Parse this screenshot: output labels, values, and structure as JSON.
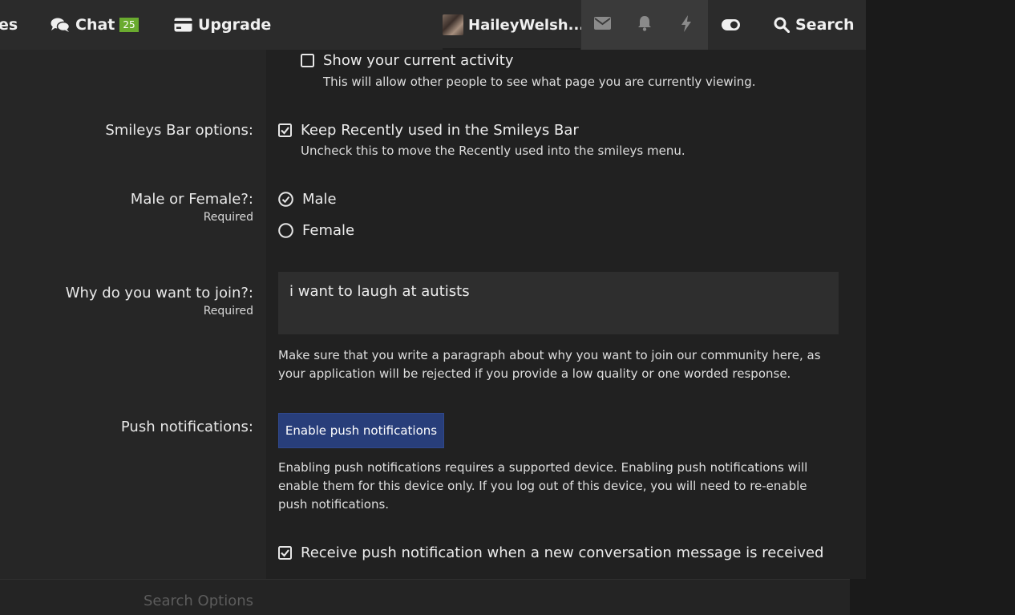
{
  "nav": {
    "partial_item": "es",
    "chat_label": "Chat",
    "chat_badge": "25",
    "upgrade_label": "Upgrade",
    "username": "HaileyWelsh...",
    "search_label": "Search"
  },
  "preferences": {
    "activity": {
      "label": "Show your current activity",
      "hint": "This will allow other people to see what page you are currently viewing.",
      "checked": false
    },
    "smileys": {
      "row_label": "Smileys Bar options:",
      "label": "Keep Recently used in the Smileys Bar",
      "hint": "Uncheck this to move the Recently used into the smileys menu.",
      "checked": true
    },
    "gender": {
      "row_label": "Male or Female?:",
      "required": "Required",
      "options": [
        "Male",
        "Female"
      ],
      "selected": "Male"
    },
    "join": {
      "row_label": "Why do you want to join?:",
      "required": "Required",
      "value": "i want to laugh at autists",
      "hint": "Make sure that you write a paragraph about why you want to join our community here, as your application will be rejected if you provide a low quality or one worded response."
    },
    "push": {
      "row_label": "Push notifications:",
      "button": "Enable push notifications",
      "hint": "Enabling push notifications requires a supported device. Enabling push notifications will enable them for this device only. If you log out of this device, you will need to re-enable push notifications.",
      "conversation_label": "Receive push notification when a new conversation message is received",
      "conversation_checked": true
    }
  },
  "footer": {
    "next_section": "Search Options"
  },
  "colors": {
    "nav_bg": "#2b2b2b",
    "badge": "#6aab2f",
    "button": "#283e7a"
  }
}
